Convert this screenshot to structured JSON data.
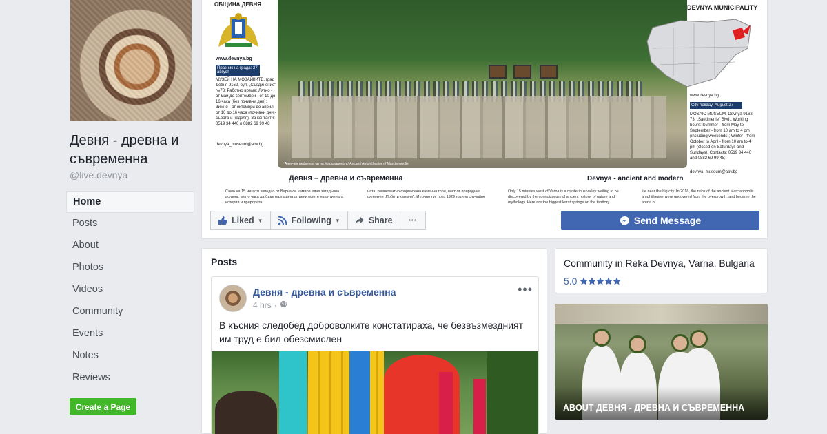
{
  "page": {
    "name": "Девня - древна и съвременна",
    "handle": "@live.devnya"
  },
  "nav": [
    "Home",
    "Posts",
    "About",
    "Photos",
    "Videos",
    "Community",
    "Events",
    "Notes",
    "Reviews"
  ],
  "create_page": "Create a Page",
  "cover": {
    "municipality_bg": "ОБЩИНА ДЕВНЯ",
    "municipality_en": "DEVNYA MUNICIPALITY",
    "url": "www.devnya.bg",
    "holiday_bg": "Празник на града: 27 август",
    "holiday_en": "City holiday: August 27",
    "museum_bg": "МУЗЕЙ НА МОЗАЙКИТЕ, град Девня 9162, бул. „Съединение\" №73; Работно време: Лятно - от май до септември - от 10 до 16 часа (без почивни дни); Зимно - от октомври до април - от 10 до 16 часа (почивни дни - събота и неделя). За контакти: 0519 34 440 и 0882 69 99 48",
    "museum_en": "MOSAIC MUSEUM, Devnya 9162, 73, „Saedinenie\" Blvd.; Working hours: Summer - from May to September - from 10 am to 4 pm (including weekends); Winter - from October to April - from 10 am to 4 pm (closed on Saturdays and Sundays). Contacts: 0519 34 440 and 0882 69 99 48;",
    "email": "devnya_museum@abv.bg",
    "caption_bg": "Девня – древна и съвременна",
    "caption_en": "Devnya - ancient and modern",
    "photo_caption": "Античен амфитеатър на Марцианопол / Ancient Amphitheater of Marcianopolis",
    "body_bg": "Само на 15 минути западно от Варна се намира една загадъчна долина, която чака да бъде разгадана от ценителите на античната история и природата.",
    "body_bg2": "ната, компетентно формирана каменна гора, част от природния феномен „Побити камъни\". И точно тук през 1929 година случайно",
    "body_en": "Only 15 minutes west of Varna is a mysterious valley waiting to be discovered by the connoisseurs of ancient history, of nature and mythology. Here are the biggest karst springs on the territory",
    "body_en2": "life near the big city. In 2016, the ruins of the ancient Marcianopolis amphitheater were uncovered from the overgrowth, and became the arena of"
  },
  "actions": {
    "liked": "Liked",
    "following": "Following",
    "share": "Share",
    "more": "···",
    "send_message": "Send Message"
  },
  "posts": {
    "title": "Posts",
    "author": "Девня - древна и съвременна",
    "time": "4 hrs",
    "text": "В късния следобед доброволките констатираха, че безвъзмездният им труд е бил обезсмислен"
  },
  "about": {
    "location": "Community in Reka Devnya, Varna, Bulgaria",
    "rating": "5.0",
    "stars": 5
  },
  "photo_card": {
    "label": "ABOUT ДЕВНЯ - ДРЕВНА И СЪВРЕМЕННА"
  },
  "colors": {
    "accent": "#4267b2",
    "link": "#365899",
    "create_green": "#42b72a",
    "background": "#e9ebee"
  }
}
